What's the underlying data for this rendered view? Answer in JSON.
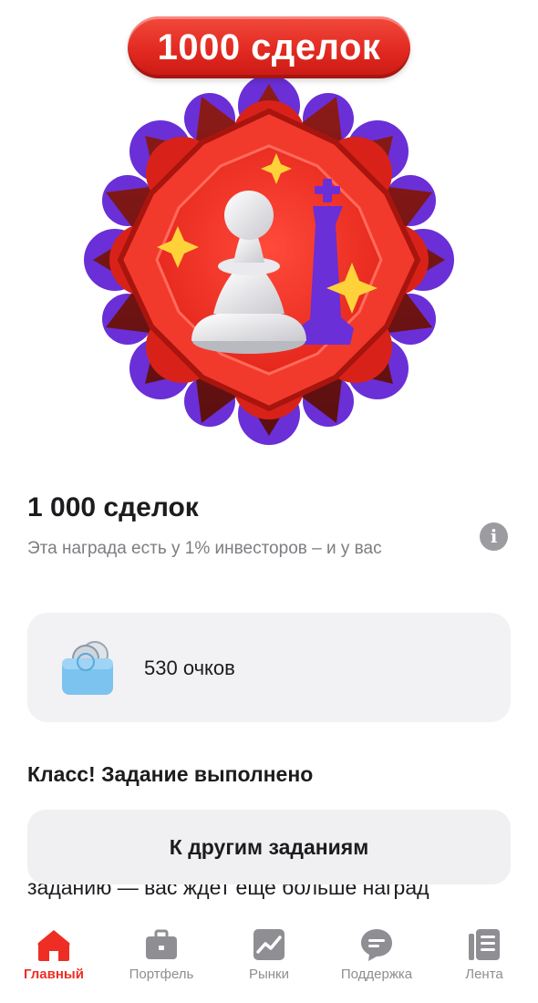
{
  "badge_pill": {
    "label": "1000 сделок"
  },
  "achievement": {
    "title": "1 000 сделок",
    "description": "Эта награда есть у 1% инвесторов – и у вас"
  },
  "points": {
    "label": "530 очков"
  },
  "task": {
    "status": "Класс! Задание выполнено",
    "partial_text": "заданию — вас ждет еще больше наград",
    "button_label": "К другим заданиям"
  },
  "tabbar": {
    "items": [
      {
        "label": "Главный",
        "icon": "home-icon",
        "active": true
      },
      {
        "label": "Портфель",
        "icon": "briefcase-icon",
        "active": false
      },
      {
        "label": "Рынки",
        "icon": "chart-icon",
        "active": false
      },
      {
        "label": "Поддержка",
        "icon": "chat-bubble-icon",
        "active": false
      },
      {
        "label": "Лента",
        "icon": "news-feed-icon",
        "active": false
      }
    ]
  },
  "colors": {
    "accent_red": "#ee2e24",
    "medal_purple": "#6a2fd6",
    "card_background": "#f2f2f5",
    "muted_text": "#7d7d82"
  }
}
